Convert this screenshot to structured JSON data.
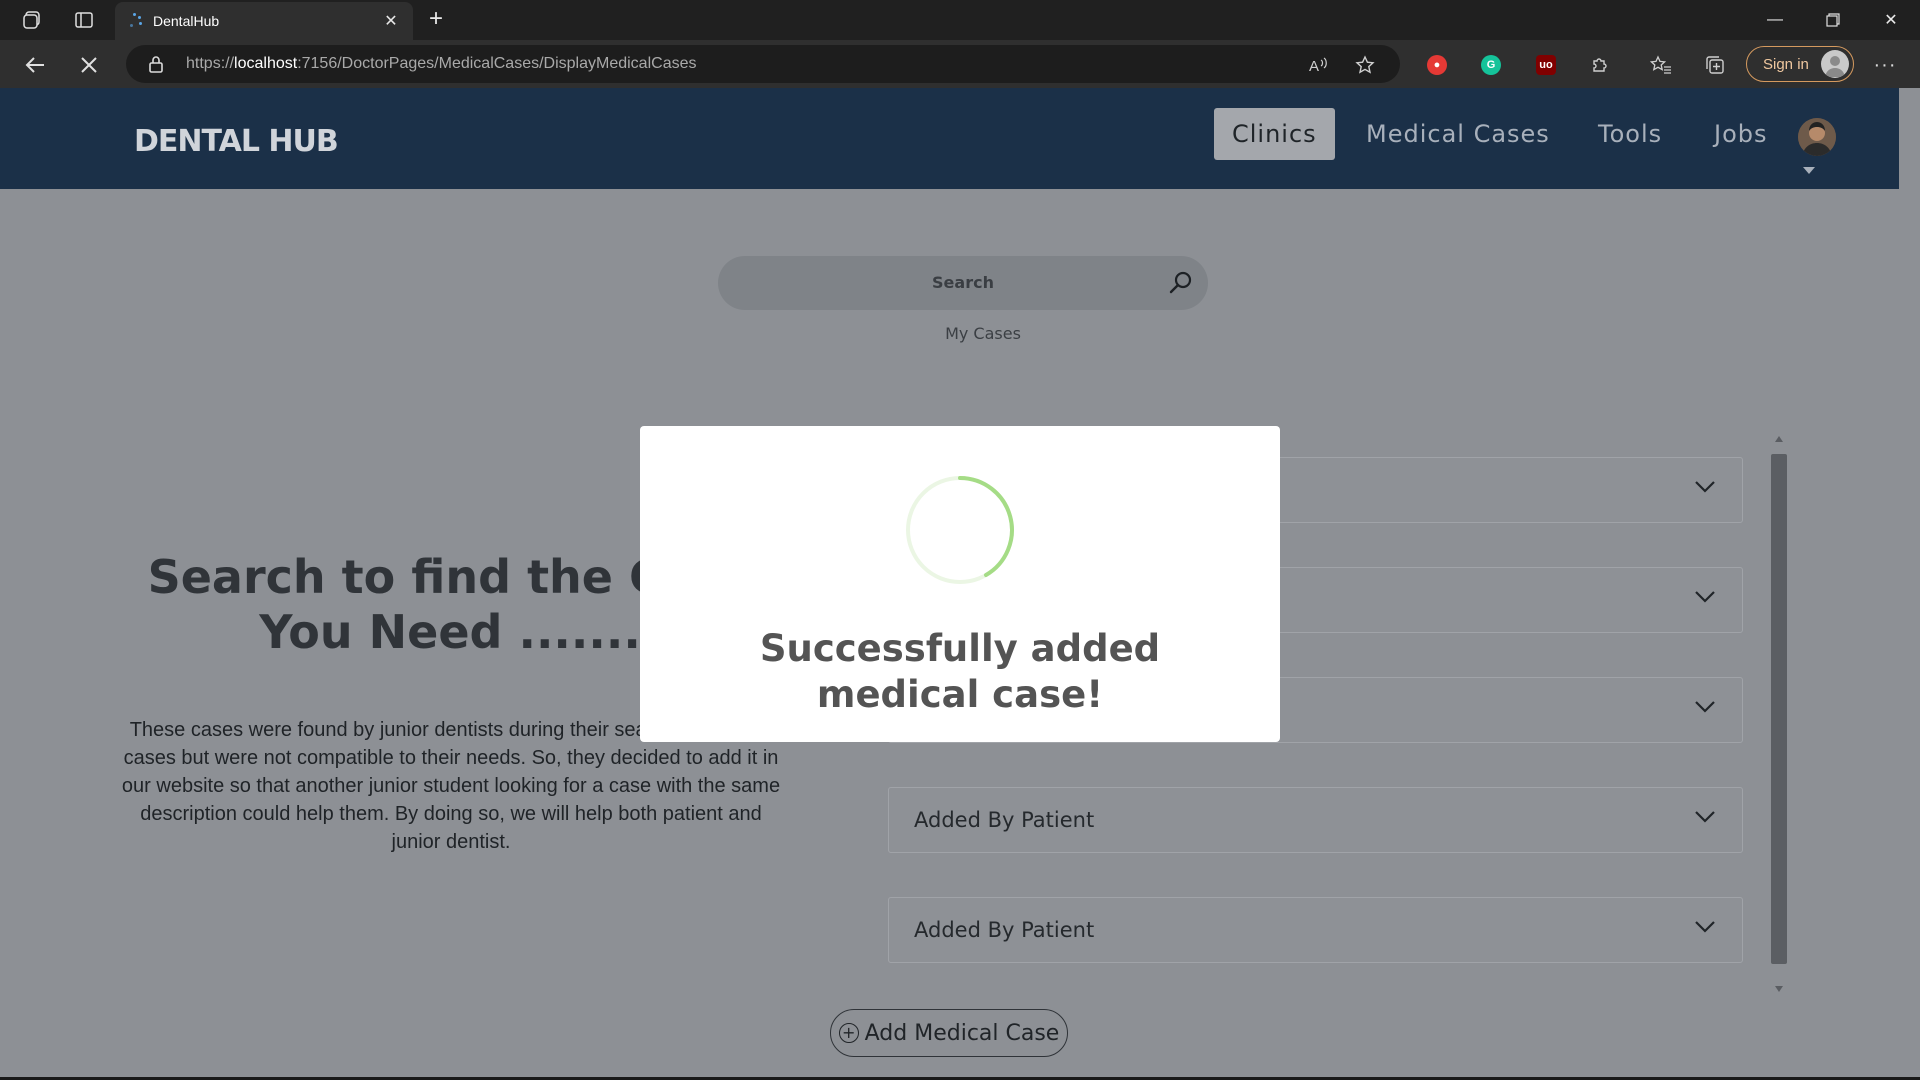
{
  "browser": {
    "tab_title": "DentalHub",
    "url_prefix": "https://",
    "url_host": "localhost",
    "url_rest": ":7156/DoctorPages/MedicalCases/DisplayMedicalCases",
    "signin_label": "Sign in"
  },
  "site": {
    "logo": "DENTAL HUB",
    "nav": [
      "Clinics",
      "Medical Cases",
      "Tools",
      "Jobs"
    ],
    "active_nav": "Clinics"
  },
  "search": {
    "placeholder": "Search",
    "my_cases_link": "My Cases"
  },
  "hero": {
    "title": "Search to find the Case You Need .......",
    "description": "These cases were found by junior dentists during their search looking for cases but were not compatible to their needs. So, they decided to add it in our website so that another junior student looking for a case with the same description could help them. By doing so, we will help both patient and junior dentist."
  },
  "cases": [
    {
      "label": ""
    },
    {
      "label": ""
    },
    {
      "label": ""
    },
    {
      "label": "Added By Patient"
    },
    {
      "label": "Added By Patient"
    }
  ],
  "add_button": "Add Medical Case",
  "modal": {
    "message": "Successfully added medical case!",
    "spinner_color": "#a5dc86"
  },
  "colors": {
    "header_bg": "#1b3048",
    "overlay_bg": "#8d9095",
    "active_nav_bg": "#a4a7ac"
  }
}
